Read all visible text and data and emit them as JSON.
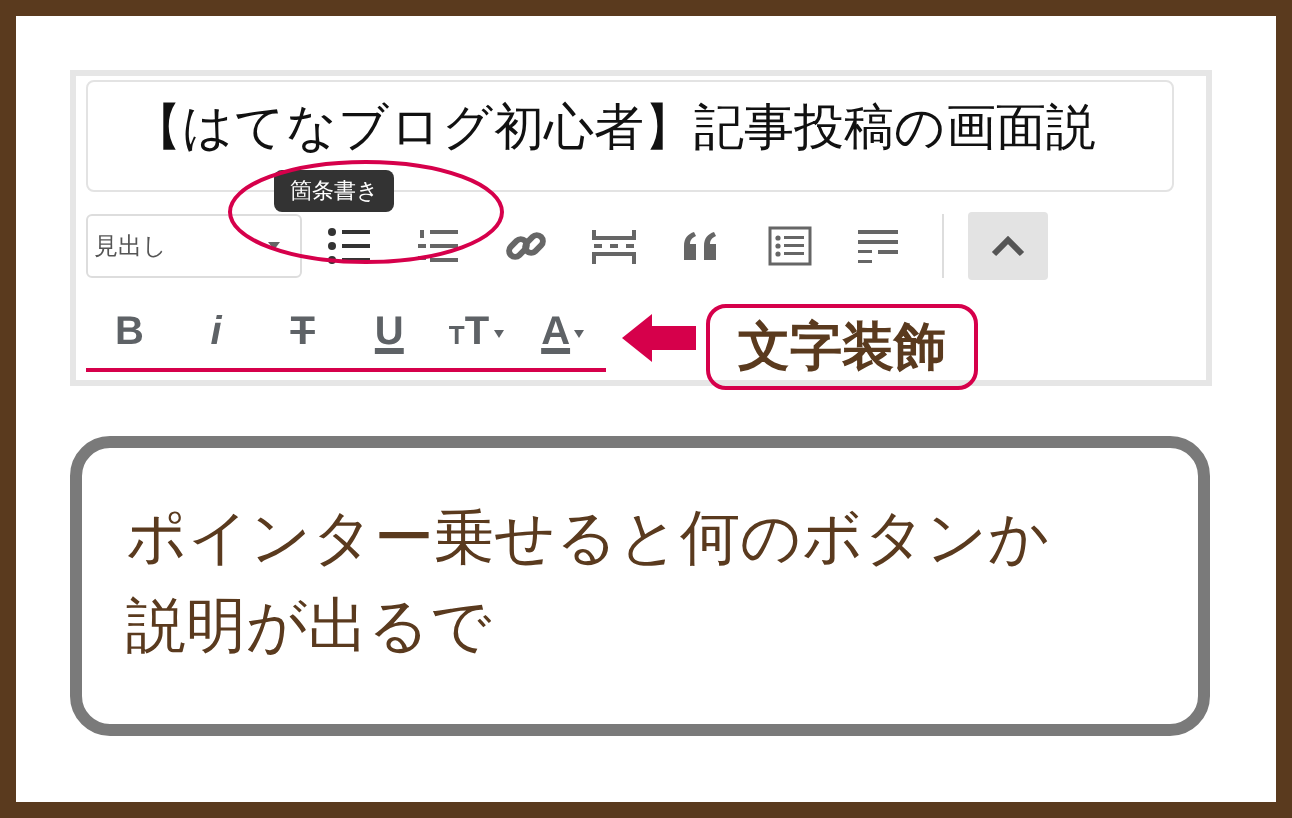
{
  "title_field": {
    "value": "【はてなブログ初心者】記事投稿の画面説"
  },
  "tooltip": {
    "text": "箇条書き"
  },
  "toolbar": {
    "heading_select": {
      "value": "見出し"
    },
    "buttons": [
      {
        "kind": "bullet-list"
      },
      {
        "kind": "numbered-list"
      },
      {
        "kind": "link"
      },
      {
        "kind": "page-break"
      },
      {
        "kind": "quote"
      },
      {
        "kind": "table-of-contents"
      },
      {
        "kind": "read-more"
      },
      {
        "kind": "collapse"
      }
    ],
    "format_buttons": [
      {
        "kind": "bold",
        "label": "B"
      },
      {
        "kind": "italic",
        "label": "i"
      },
      {
        "kind": "strikethrough",
        "label": "T"
      },
      {
        "kind": "underline",
        "label": "U"
      },
      {
        "kind": "font-size",
        "small": "T",
        "label": "T"
      },
      {
        "kind": "text-color",
        "label": "A"
      }
    ]
  },
  "annotations": {
    "callout": "文字装飾",
    "note": "ポインター乗せると何のボタンか説明が出るで"
  }
}
